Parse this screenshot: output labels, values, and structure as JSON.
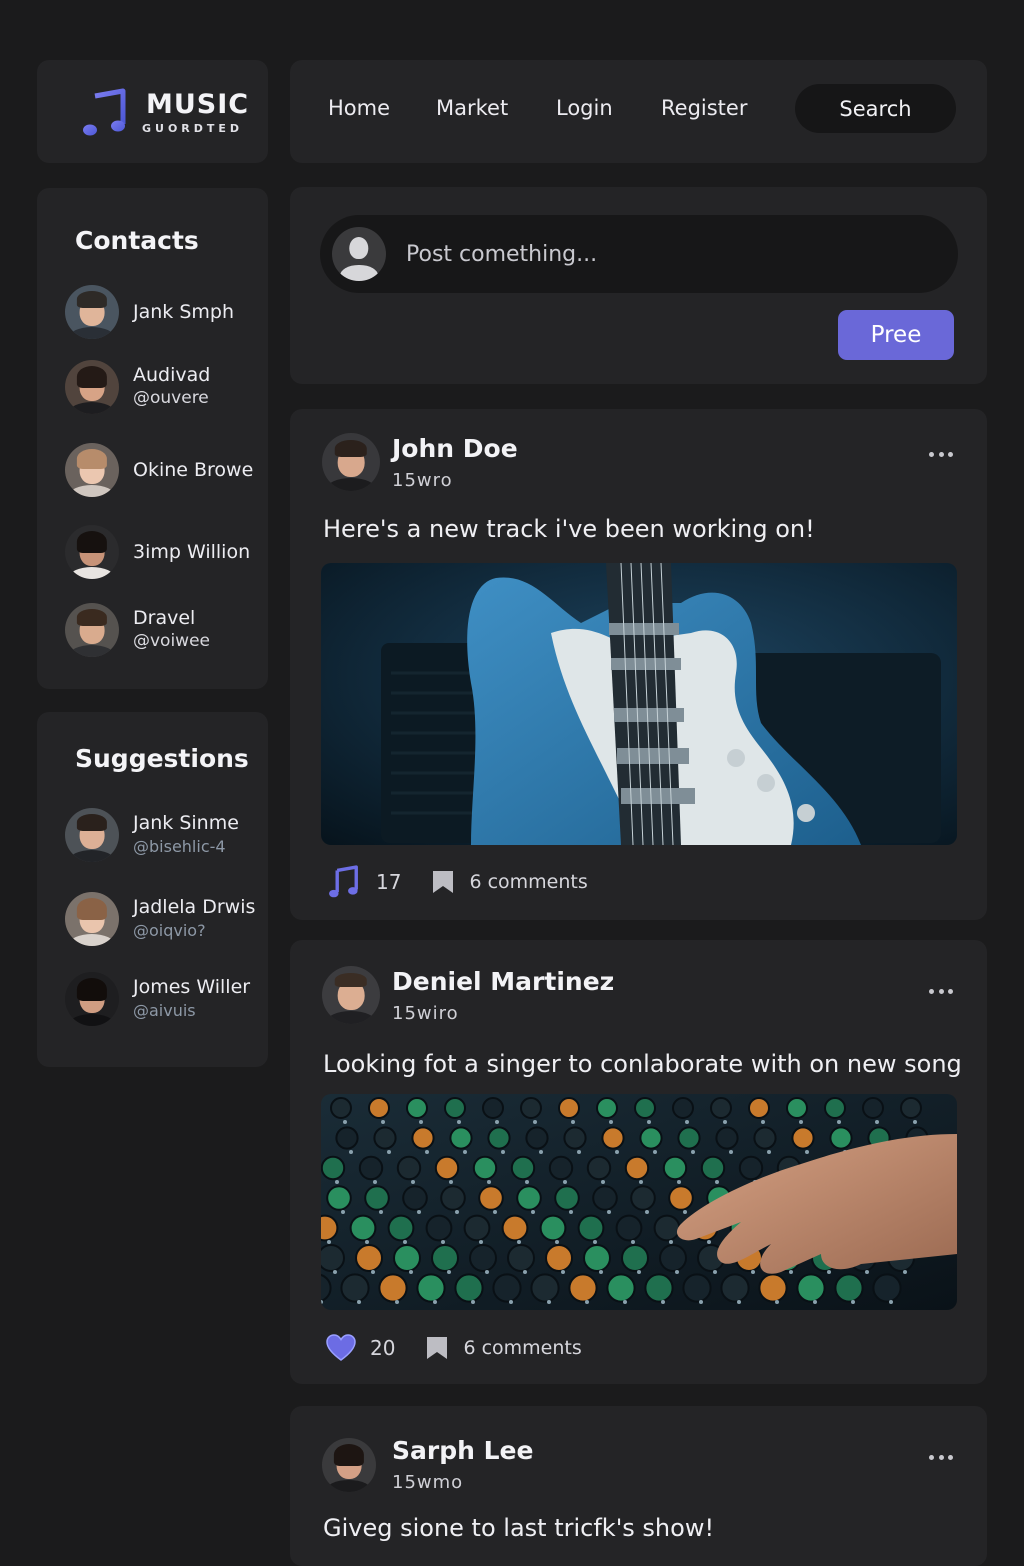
{
  "brand": {
    "title": "MUSIC",
    "subtitle": "GUORDTED"
  },
  "nav": {
    "links": [
      "Home",
      "Market",
      "Login",
      "Register"
    ],
    "search_label": "Search"
  },
  "contacts": {
    "title": "Contacts",
    "items": [
      {
        "name": "Jank Smph",
        "handle": ""
      },
      {
        "name": "Audivad",
        "handle": "@ouvere"
      },
      {
        "name": "Okine Browe",
        "handle": ""
      },
      {
        "name": "3imp Willion",
        "handle": ""
      },
      {
        "name": "Dravel",
        "handle": "@voiwee"
      }
    ]
  },
  "suggestions": {
    "title": "Suggestions",
    "items": [
      {
        "name": "Jank Sinme",
        "handle": "@bisehlic-4"
      },
      {
        "name": "Jadlela Drwis",
        "handle": "@oiqvio?"
      },
      {
        "name": "Jomes Willer",
        "handle": "@aivuis"
      }
    ]
  },
  "composer": {
    "placeholder": "Post comething...",
    "button": "Pree"
  },
  "posts": [
    {
      "author": "John Doe",
      "time": "15wro",
      "text": "Here's a new      track i've been working on!",
      "image": "electric-guitar-photo",
      "likes": "17",
      "comments": "6 comments",
      "like_icon": "music-note-icon"
    },
    {
      "author": "Deniel Martinez",
      "time": "15wiro",
      "text": "Looking fot a singer to conlaborate with on new song",
      "image": "mixing-console-photo",
      "likes": "20",
      "comments": "6 comments",
      "like_icon": "heart-icon"
    },
    {
      "author": "Sarph Lee",
      "time": "15wmo",
      "text": "Giveg sione to last tricfk's show!"
    }
  ],
  "colors": {
    "accent": "#6a68d8",
    "background": "#1b1b1c",
    "card": "#242426"
  }
}
